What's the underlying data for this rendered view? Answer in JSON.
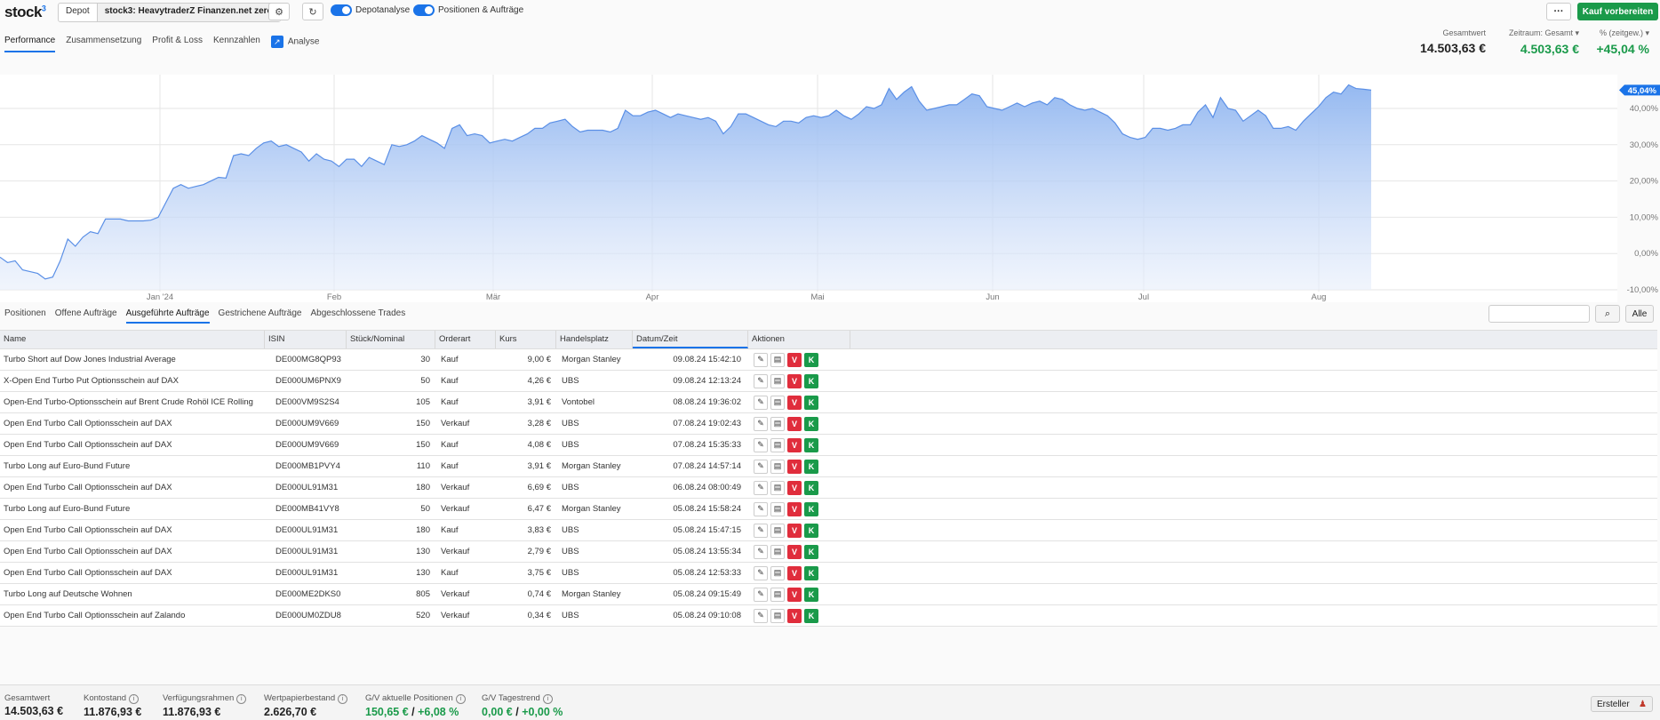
{
  "brand": {
    "name": "stock",
    "sup": "3"
  },
  "topbar": {
    "depot_label": "Depot",
    "depot_value": "stock3: HeavytraderZ Finanzen.net zero",
    "toggle1": "Depotanalyse",
    "toggle2": "Positionen & Aufträge",
    "more": "···",
    "kauf": "Kauf vorbereiten"
  },
  "tabs": [
    "Performance",
    "Zusammensetzung",
    "Profit & Loss",
    "Kennzahlen",
    "Analyse"
  ],
  "summary": {
    "gesamtwert_label": "Gesamtwert",
    "gesamtwert": "14.503,63 €",
    "zeitraum_label": "Zeitraum: Gesamt",
    "zeitraum": "4.503,63 €",
    "pct_label": "% (zeitgew.)",
    "pct": "+45,04 %"
  },
  "chart_data": {
    "type": "area",
    "x_ticks": [
      "Jan '24",
      "Feb",
      "Mär",
      "Apr",
      "Mai",
      "Jun",
      "Jul",
      "Aug"
    ],
    "y_ticks": [
      "40,00%",
      "30,00%",
      "20,00%",
      "10,00%",
      "0,00%",
      "-10,00%"
    ],
    "ylim": [
      -10,
      50
    ],
    "current_label": "45,04%",
    "series": [
      {
        "values": [
          -1,
          -2.5,
          -2,
          -4.5,
          -5,
          -5.5,
          -7,
          -6.5,
          -2,
          4,
          2,
          4.5,
          6,
          5.5,
          9.5,
          9.5,
          9.5,
          9,
          9,
          9,
          9.2,
          10,
          14,
          18,
          19,
          18,
          18.5,
          19,
          20,
          21,
          20.8,
          27,
          27.5,
          27,
          29,
          30.5,
          31,
          29.5,
          30,
          29,
          28,
          25.5,
          27.5,
          26,
          25.5,
          24,
          26,
          26,
          24,
          26.5,
          25.5,
          24.5,
          30,
          29.5,
          30,
          31,
          32.5,
          31.5,
          30.5,
          29,
          34.5,
          35.5,
          32.5,
          33,
          32.5,
          30.5,
          31,
          31.5,
          31,
          32,
          33,
          34.5,
          34.5,
          36,
          36.5,
          37,
          35,
          33.5,
          34,
          34,
          34,
          33.5,
          34.5,
          39.5,
          38,
          38,
          39,
          39.5,
          38.5,
          37.5,
          38.5,
          38,
          37.5,
          37,
          37.5,
          36.5,
          33,
          35,
          38.5,
          38.5,
          37.5,
          36.5,
          35.5,
          35,
          36.5,
          36.5,
          36,
          37.5,
          38,
          37.5,
          38,
          39.5,
          38,
          37,
          38.5,
          40.5,
          40,
          41,
          45.5,
          42.5,
          44.5,
          46,
          42,
          39.5,
          40,
          40.5,
          41,
          41,
          42.5,
          44,
          43.5,
          40.5,
          40,
          39.5,
          40.5,
          41.5,
          40.5,
          41.5,
          42,
          41,
          43,
          42.5,
          41,
          40,
          39.5,
          40,
          39,
          38,
          36,
          33,
          32,
          31.5,
          32,
          34.5,
          34.5,
          34,
          34.5,
          35.5,
          35.5,
          39,
          41,
          37.5,
          43,
          40,
          39.5,
          36.5,
          38,
          39.5,
          38,
          34.5,
          34.5,
          35,
          34,
          36.5,
          38.5,
          40.5,
          43,
          44.5,
          44,
          46.5,
          45.5,
          45.3,
          45.04
        ]
      }
    ]
  },
  "subtabs": [
    "Positionen",
    "Offene Aufträge",
    "Ausgeführte Aufträge",
    "Gestrichene Aufträge",
    "Abgeschlossene Trades"
  ],
  "filter": {
    "alle": "Alle"
  },
  "table": {
    "headers": [
      "Name",
      "ISIN",
      "Stück/Nominal",
      "Orderart",
      "Kurs",
      "Handelsplatz",
      "Datum/Zeit",
      "Aktionen"
    ],
    "rows": [
      [
        "Turbo Short auf Dow Jones Industrial Average",
        "DE000MG8QP93",
        "30",
        "Kauf",
        "9,00 €",
        "Morgan Stanley",
        "09.08.24 15:42:10"
      ],
      [
        "X-Open End Turbo Put Optionsschein auf DAX",
        "DE000UM6PNX9",
        "50",
        "Kauf",
        "4,26 €",
        "UBS",
        "09.08.24 12:13:24"
      ],
      [
        "Open-End Turbo-Optionsschein auf Brent Crude Rohöl ICE Rolling",
        "DE000VM9S2S4",
        "105",
        "Kauf",
        "3,91 €",
        "Vontobel",
        "08.08.24 19:36:02"
      ],
      [
        "Open End Turbo Call Optionsschein auf DAX",
        "DE000UM9V669",
        "150",
        "Verkauf",
        "3,28 €",
        "UBS",
        "07.08.24 19:02:43"
      ],
      [
        "Open End Turbo Call Optionsschein auf DAX",
        "DE000UM9V669",
        "150",
        "Kauf",
        "4,08 €",
        "UBS",
        "07.08.24 15:35:33"
      ],
      [
        "Turbo Long auf Euro-Bund Future",
        "DE000MB1PVY4",
        "110",
        "Kauf",
        "3,91 €",
        "Morgan Stanley",
        "07.08.24 14:57:14"
      ],
      [
        "Open End Turbo Call Optionsschein auf DAX",
        "DE000UL91M31",
        "180",
        "Verkauf",
        "6,69 €",
        "UBS",
        "06.08.24 08:00:49"
      ],
      [
        "Turbo Long auf Euro-Bund Future",
        "DE000MB41VY8",
        "50",
        "Verkauf",
        "6,47 €",
        "Morgan Stanley",
        "05.08.24 15:58:24"
      ],
      [
        "Open End Turbo Call Optionsschein auf DAX",
        "DE000UL91M31",
        "180",
        "Kauf",
        "3,83 €",
        "UBS",
        "05.08.24 15:47:15"
      ],
      [
        "Open End Turbo Call Optionsschein auf DAX",
        "DE000UL91M31",
        "130",
        "Verkauf",
        "2,79 €",
        "UBS",
        "05.08.24 13:55:34"
      ],
      [
        "Open End Turbo Call Optionsschein auf DAX",
        "DE000UL91M31",
        "130",
        "Kauf",
        "3,75 €",
        "UBS",
        "05.08.24 12:53:33"
      ],
      [
        "Turbo Long auf Deutsche Wohnen",
        "DE000ME2DKS0",
        "805",
        "Verkauf",
        "0,74 €",
        "Morgan Stanley",
        "05.08.24 09:15:49"
      ],
      [
        "Open End Turbo Call Optionsschein auf Zalando",
        "DE000UM0ZDU8",
        "520",
        "Verkauf",
        "0,34 €",
        "UBS",
        "05.08.24 09:10:08"
      ]
    ],
    "action_v": "V",
    "action_k": "K"
  },
  "footer": {
    "gesamtwert_label": "Gesamtwert",
    "gesamtwert": "14.503,63 €",
    "kontostand_label": "Kontostand",
    "kontostand": "11.876,93 €",
    "verf_label": "Verfügungsrahmen",
    "verf": "11.876,93 €",
    "wp_label": "Wertpapierbestand",
    "wp": "2.626,70 €",
    "gv_label": "G/V aktuelle Positionen",
    "gv_eur": "150,65 €",
    "gv_pct": "+6,08 %",
    "gvt_label": "G/V Tagestrend",
    "gvt_eur": "0,00 €",
    "gvt_pct": "+0,00 %",
    "ersteller": "Ersteller"
  },
  "colors": {
    "accent": "#1a73e8",
    "green": "#1a9a4a",
    "red": "#e02d3c",
    "area": "#8fb5f0"
  }
}
